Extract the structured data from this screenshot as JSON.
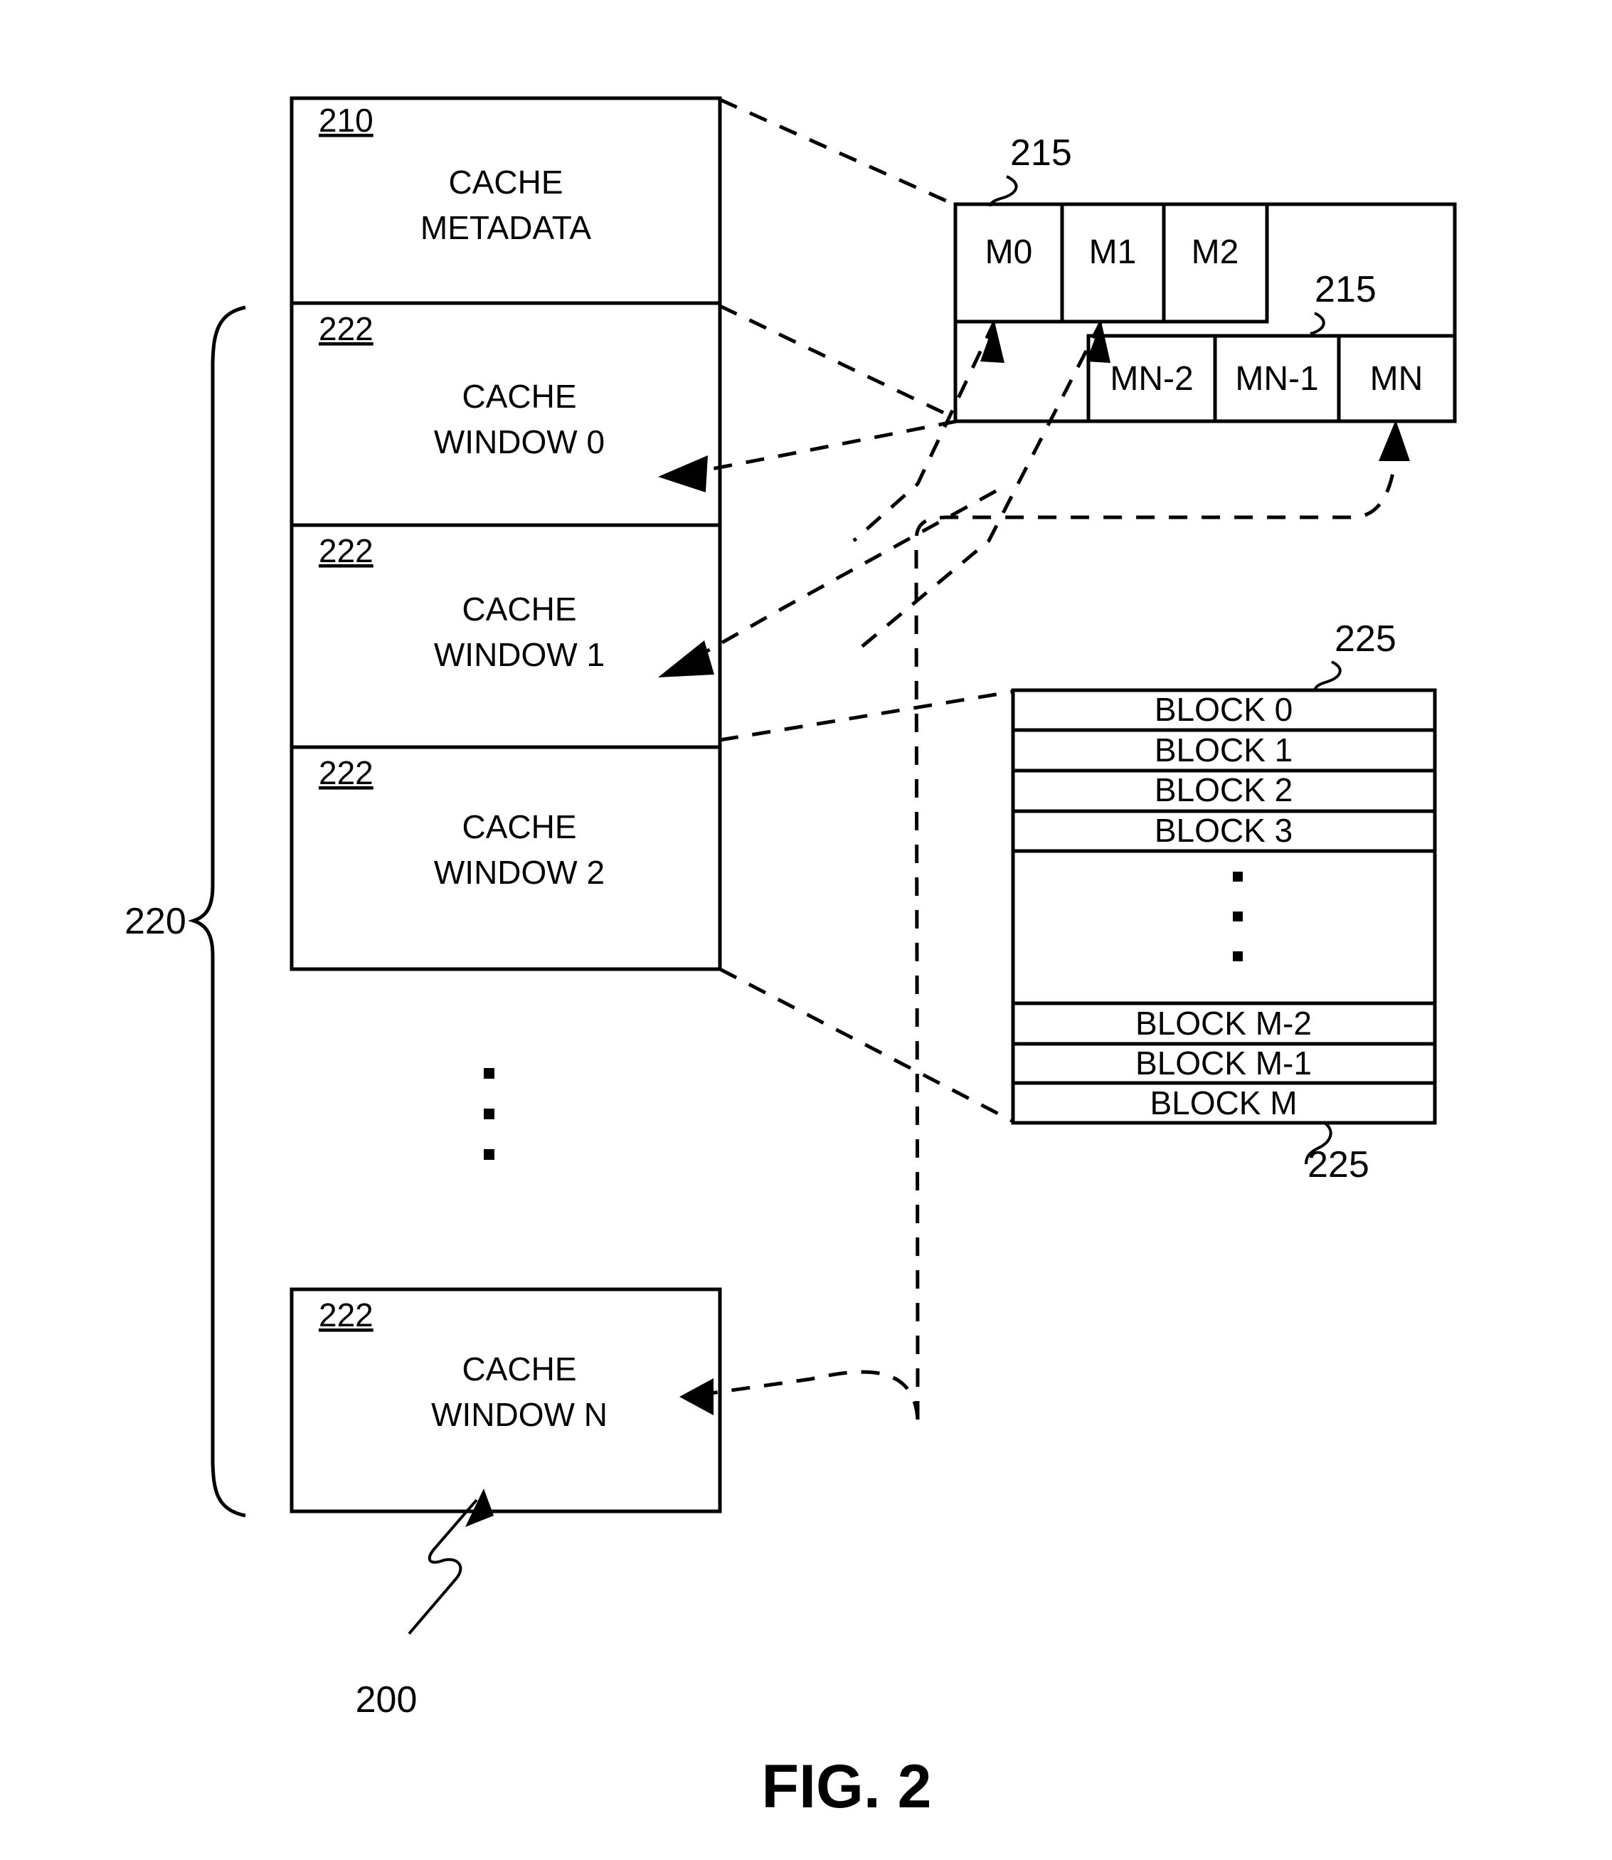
{
  "figure": {
    "caption": "FIG. 2",
    "overall_ref": "200"
  },
  "left_column": {
    "group_ref": "220",
    "metadata_block": {
      "ref": "210",
      "line1": "CACHE",
      "line2": "METADATA"
    },
    "windows": [
      {
        "ref": "222",
        "line1": "CACHE",
        "line2": "WINDOW 0"
      },
      {
        "ref": "222",
        "line1": "CACHE",
        "line2": "WINDOW 1"
      },
      {
        "ref": "222",
        "line1": "CACHE",
        "line2": "WINDOW 2"
      },
      {
        "ref": "222",
        "line1": "CACHE",
        "line2": "WINDOW N"
      }
    ],
    "ellipsis": "vertical-three-dots"
  },
  "metadata_table": {
    "ref_top": "215",
    "ref_bottom": "215",
    "top_row": [
      "M0",
      "M1",
      "M2"
    ],
    "bottom_row": [
      "MN-2",
      "MN-1",
      "MN"
    ]
  },
  "blocks_table": {
    "ref_top": "225",
    "ref_bottom": "225",
    "rows_top": [
      "BLOCK 0",
      "BLOCK 1",
      "BLOCK 2",
      "BLOCK 3"
    ],
    "ellipsis": "vertical-three-dots",
    "rows_bottom": [
      "BLOCK M-2",
      "BLOCK M-1",
      "BLOCK M"
    ]
  },
  "colors": {
    "line": "#000000",
    "fill": "#ffffff",
    "text": "#000000"
  }
}
